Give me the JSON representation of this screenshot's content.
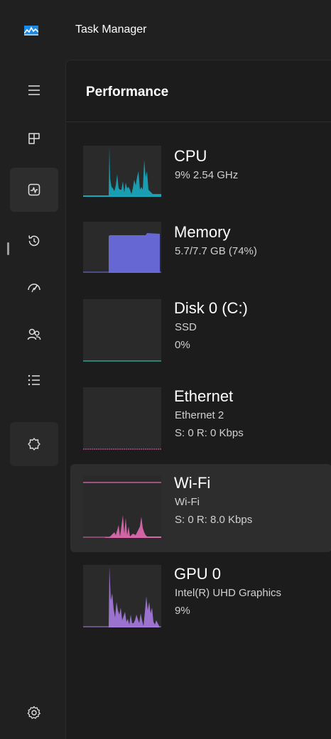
{
  "window": {
    "title": "Task Manager"
  },
  "page": {
    "title": "Performance"
  },
  "nav": {
    "items": [
      {
        "icon": "hamburger-menu-icon"
      },
      {
        "icon": "processes-icon"
      },
      {
        "icon": "performance-icon",
        "active": true
      },
      {
        "icon": "app-history-icon"
      },
      {
        "icon": "startup-apps-icon"
      },
      {
        "icon": "users-icon"
      },
      {
        "icon": "details-icon"
      },
      {
        "icon": "services-icon"
      },
      {
        "icon": "settings-icon"
      }
    ]
  },
  "colors": {
    "cpu": "#17b2c8",
    "memory": "#6d6ee4",
    "disk": "#2f9c8b",
    "ethernet": "#c9489a",
    "wifi": "#e36ab3",
    "gpu": "#a77be0"
  },
  "resources": [
    {
      "name": "CPU",
      "line1": "9% 2.54 GHz",
      "line2": "",
      "graph_values": [
        0,
        0,
        0,
        0,
        0,
        0,
        0,
        0,
        0,
        0,
        0,
        0,
        0,
        0,
        0,
        0,
        0,
        0,
        0,
        0,
        0,
        0,
        0,
        0,
        0,
        0,
        0,
        0,
        0,
        0,
        0,
        0,
        0,
        0,
        0,
        0,
        0,
        0,
        0,
        0,
        0,
        0,
        0,
        0,
        0,
        0,
        0,
        0,
        0,
        0,
        0,
        0,
        0,
        95,
        35,
        15,
        12,
        8,
        5,
        55,
        25,
        12,
        10,
        20,
        8,
        45,
        12,
        25,
        5,
        10,
        15,
        35,
        20,
        55,
        8,
        15,
        12,
        10,
        8,
        52,
        30,
        35,
        12,
        8,
        6,
        5,
        4,
        4,
        5,
        6,
        5,
        4,
        5,
        6,
        5,
        4,
        5,
        6,
        7,
        4,
        5,
        6,
        5,
        4,
        6,
        8,
        12,
        20,
        50,
        15,
        25,
        5
      ]
    },
    {
      "name": "Memory",
      "line1": "5.7/7.7 GB (74%)",
      "line2": "",
      "graph_values_note": "flat",
      "fill_percent": 74
    },
    {
      "name": "Disk 0 (C:)",
      "line1": "SSD",
      "line2": "0%"
    },
    {
      "name": "Ethernet",
      "line1": "Ethernet 2",
      "line2": "S: 0 R: 0 Kbps"
    },
    {
      "name": "Wi-Fi",
      "line1": "Wi-Fi",
      "line2": "S: 0 R: 8.0 Kbps",
      "selected": true
    },
    {
      "name": "GPU 0",
      "line1": "Intel(R) UHD Graphics",
      "line2": "9%"
    }
  ]
}
